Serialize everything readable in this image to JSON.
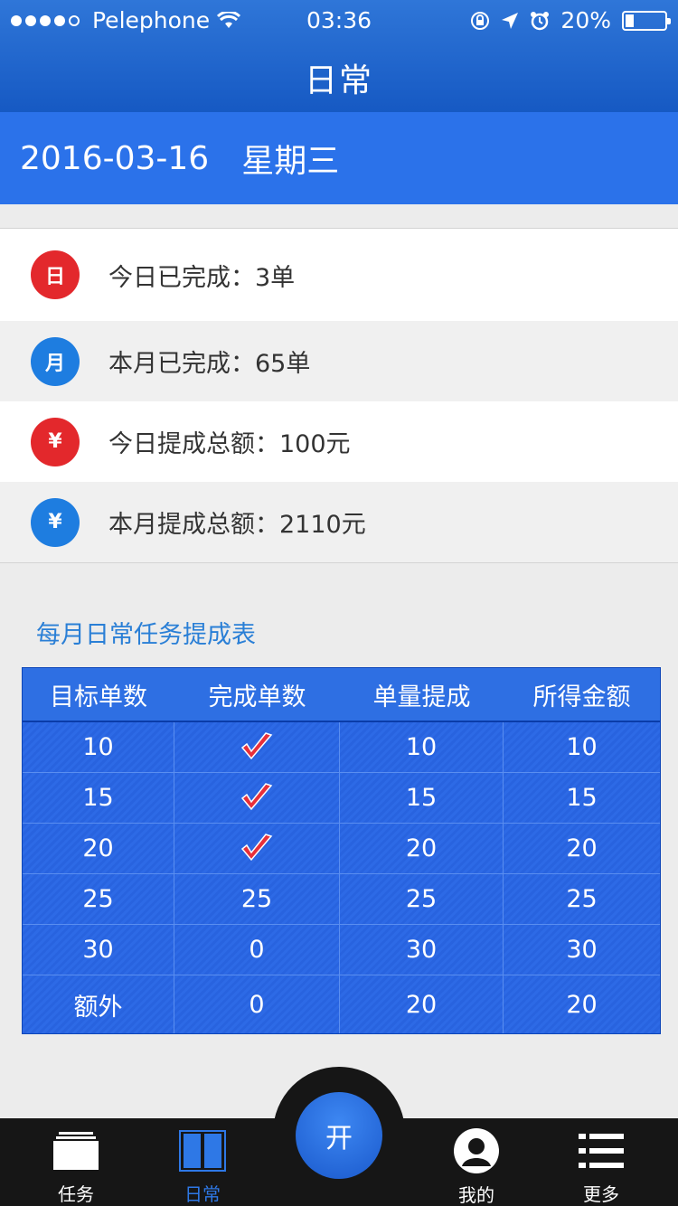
{
  "status_bar": {
    "carrier": "Pelephone",
    "time": "03:36",
    "battery": "20%"
  },
  "header": {
    "title": "日常"
  },
  "datebar": {
    "date": "2016-03-16",
    "weekday": "星期三"
  },
  "stats": [
    {
      "icon": "日",
      "label": "今日已完成：3单",
      "color": "#e3282c"
    },
    {
      "icon": "月",
      "label": "本月已完成：65单",
      "color": "#1e7de0"
    },
    {
      "icon": "¥",
      "label": "今日提成总额：100元",
      "color": "#e3282c"
    },
    {
      "icon": "¥",
      "label": "本月提成总额：2110元",
      "color": "#1e7de0"
    }
  ],
  "table": {
    "title": "每月日常任务提成表",
    "headers": [
      "目标单数",
      "完成单数",
      "单量提成",
      "所得金额"
    ],
    "rows": [
      {
        "target": "10",
        "done": "✔",
        "rate": "10",
        "amount": "10"
      },
      {
        "target": "15",
        "done": "✔",
        "rate": "15",
        "amount": "15"
      },
      {
        "target": "20",
        "done": "✔",
        "rate": "20",
        "amount": "20"
      },
      {
        "target": "25",
        "done": "25",
        "rate": "25",
        "amount": "25"
      },
      {
        "target": "30",
        "done": "0",
        "rate": "30",
        "amount": "30"
      },
      {
        "target": "额外",
        "done": "0",
        "rate": "20",
        "amount": "20"
      }
    ]
  },
  "tabbar": {
    "tasks": "任务",
    "daily": "日常",
    "fab": "开",
    "mine": "我的",
    "more": "更多"
  },
  "colors": {
    "accent": "#2b72ea",
    "active_tab": "#2e78e6"
  }
}
